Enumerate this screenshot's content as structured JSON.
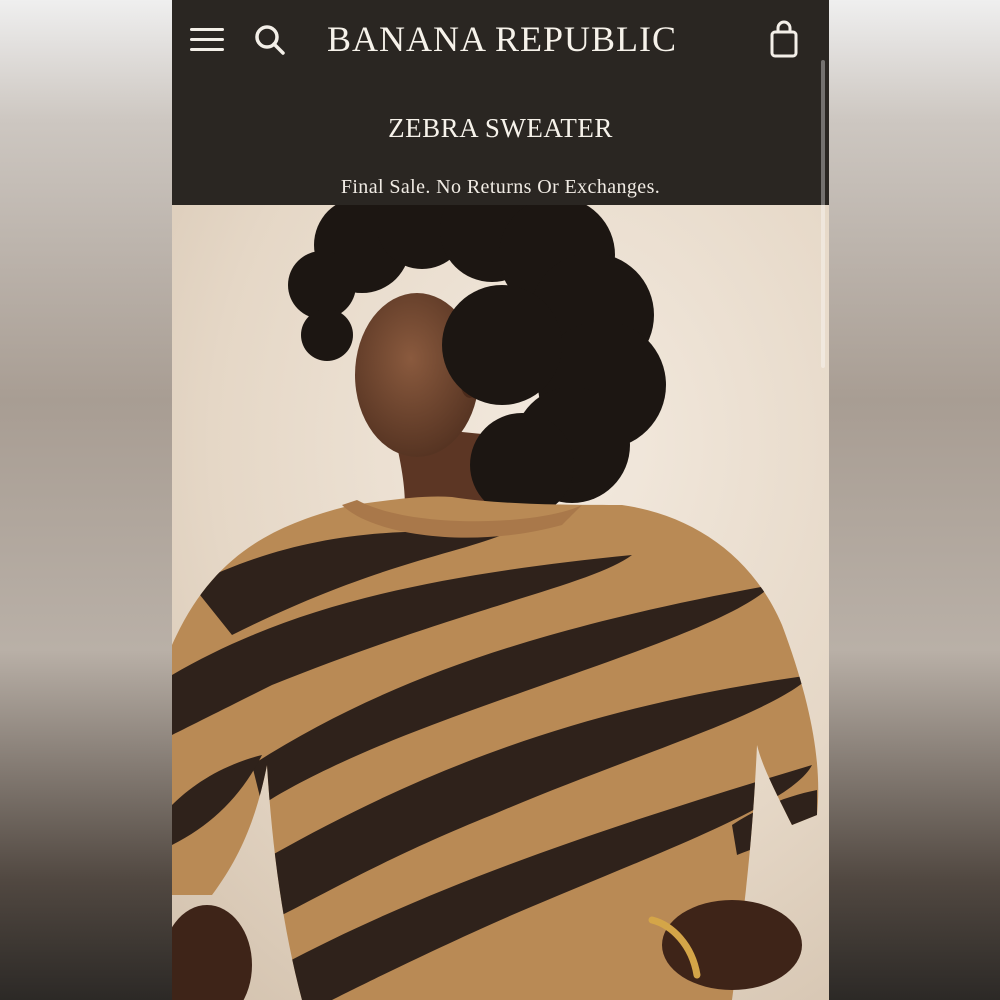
{
  "header": {
    "brand": "BANANA REPUBLIC",
    "icons": {
      "menu": "hamburger-menu-icon",
      "search": "search-icon",
      "bag": "shopping-bag-icon"
    }
  },
  "product": {
    "title": "ZEBRA SWEATER",
    "notice": "Final Sale. No Returns Or Exchanges.",
    "image_alt": "Model wearing brown and camel zebra-stripe crewneck sweater"
  },
  "colors": {
    "header_bg": "#2a2622",
    "header_text": "#f3efe8",
    "backdrop": "#e8dccb",
    "sweater_camel": "#b98a55",
    "sweater_brown": "#2f221b"
  }
}
